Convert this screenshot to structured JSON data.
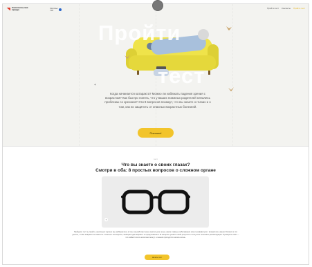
{
  "header": {
    "logo_text": "Комсомольская правда",
    "partner_text": "Здоровье глаз",
    "nav": [
      "Пройти тест",
      "Контакты",
      "Пройти тест"
    ]
  },
  "hero": {
    "title_line1": "Пройти",
    "title_line2": "тест",
    "description": "Когда начинается катаракта? Можно ли избежать падения зрения с возрастом? Как быстро понять, что у ваших пожилых родителей начались проблемы со зрением? Эти 8 вопросов покажут, что вы знаете о глазах и о том, как их защитить от опасных возрастных болезней.",
    "cta_label": "Поехали!"
  },
  "quiz": {
    "overline": "тест",
    "title_line1": "Что вы знаете о своих глазах?",
    "title_line2": "Смотри в оба: 8 простых вопросов о сложном органе",
    "body": "Пройдите тест и узнайте, насколько хорошо вы разбираетесь в том, как работает наше зрительное чутьё, какие главные заболевания могут развиваться с возрастом у ваших близких и что делать, чтобы вовремя их заметить. Ответьте на вопросы, выбирая один вариант из предложенных. В конце вы узнаете свой результат и получите полезные рекомендации. Проверьте себя — это займёт всего несколько минут, а знания пригодятся на всю жизнь.",
    "cta_label": "Начать тест"
  },
  "colors": {
    "accent_yellow": "#f2c42b",
    "sofa_yellow": "#efe34a",
    "brand_red": "#e03a2a",
    "hero_bg": "#f3f3f0"
  }
}
